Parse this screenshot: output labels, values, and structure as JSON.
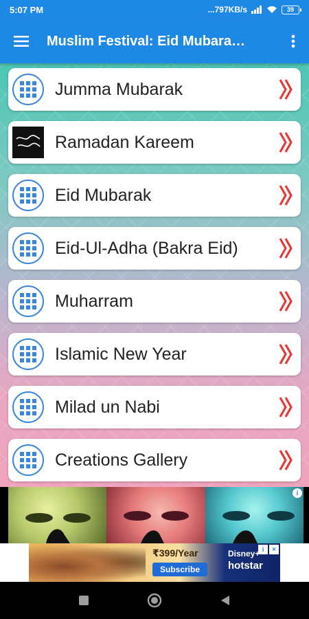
{
  "status_bar": {
    "time": "5:07 PM",
    "network_speed": "...797KB/s",
    "battery": "39"
  },
  "app_bar": {
    "title": "Muslim Festival: Eid Mubara…",
    "menu_icon": "hamburger-menu-icon",
    "more_icon": "more-vert-icon"
  },
  "menu": {
    "items": [
      {
        "label": "Jumma Mubarak",
        "icon": "grid-icon"
      },
      {
        "label": "Ramadan Kareem",
        "icon": "ramadan-thumbnail"
      },
      {
        "label": "Eid Mubarak",
        "icon": "grid-icon"
      },
      {
        "label": "Eid-Ul-Adha (Bakra Eid)",
        "icon": "grid-icon"
      },
      {
        "label": "Muharram",
        "icon": "grid-icon"
      },
      {
        "label": "Islamic New Year",
        "icon": "grid-icon"
      },
      {
        "label": "Milad un Nabi",
        "icon": "grid-icon"
      },
      {
        "label": "Creations Gallery",
        "icon": "grid-icon"
      }
    ]
  },
  "ads": {
    "banner": {
      "price": "₹399/Year",
      "subscribe": "Subscribe",
      "brand_top": "Disney+",
      "brand": "hotstar"
    }
  },
  "colors": {
    "primary": "#1e88e5",
    "chevron": "#e53935",
    "icon_blue": "#3a86d9"
  }
}
